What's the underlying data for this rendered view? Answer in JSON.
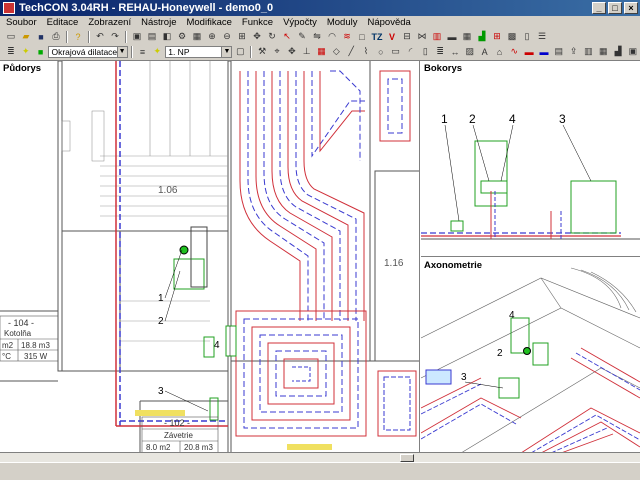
{
  "window": {
    "title": "TechCON 3.04RH - REHAU-Honeywell - demo0_0"
  },
  "menu": [
    "Soubor",
    "Editace",
    "Zobrazení",
    "Nástroje",
    "Modifikace",
    "Funkce",
    "Výpočty",
    "Moduly",
    "Nápověda"
  ],
  "toolbar": {
    "layer_combo": "Okrajová dilatace",
    "floor_combo": "1. NP",
    "icons_text": [
      "TZ",
      "V"
    ]
  },
  "panes": {
    "floorplan_title": "Půdorys",
    "side_title": "Bokorys",
    "axo_title": "Axonometrie"
  },
  "floorplan": {
    "room_106": "1.06",
    "room_116": "1.16",
    "room_104_label": "- 104 -",
    "room_104_name": "Kotolňa",
    "room_104_area": "m2",
    "room_104_volume": "18.8 m3",
    "room_104_temp": "°C",
    "room_104_power": "315 W",
    "room_102_label": "- 102 -",
    "room_102_name": "Závetrie",
    "room_102_area": "8.0 m2",
    "room_102_volume": "20.8 m3",
    "callouts": [
      "1",
      "2",
      "3",
      "4"
    ]
  },
  "side_view": {
    "callouts": [
      "1",
      "2",
      "4",
      "3"
    ]
  },
  "axo_view": {
    "callouts": [
      "2",
      "3",
      "4"
    ]
  },
  "colors": {
    "pipe_red": "#d0303a",
    "pipe_blue": "#3a3ad0",
    "equipment_green": "#20a020",
    "wall": "#606060"
  }
}
